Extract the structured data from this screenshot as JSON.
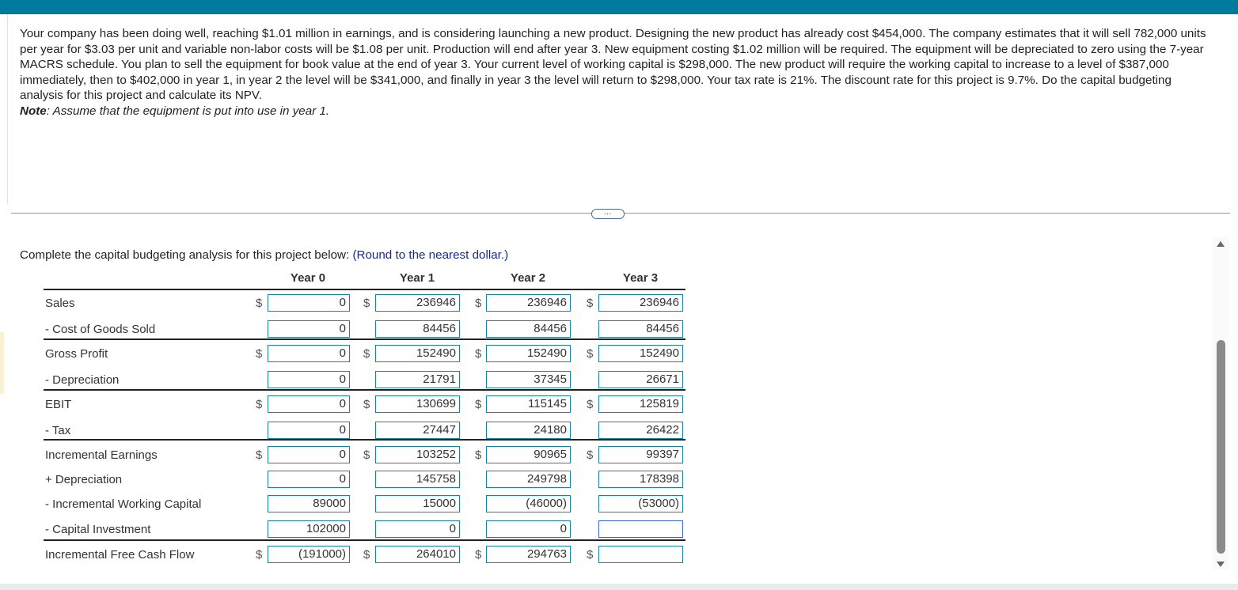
{
  "problem": {
    "text": "Your company has been doing well, reaching $1.01 million in earnings, and is considering launching a new product. Designing the new product has already cost $454,000. The company estimates that it will sell 782,000 units per year for $3.03 per unit and variable non-labor costs will be $1.08 per unit. Production will end after year 3. New equipment costing $1.02 million will be required. The equipment will be depreciated to zero using the 7-year MACRS schedule. You plan to sell the equipment for book value at the end of year 3. Your current level of working capital is $298,000. The new product will require the working capital to increase to a level of $387,000 immediately, then to $402,000 in year 1, in year 2 the level will be $341,000, and finally in year 3 the level will return to $298,000. Your tax rate is 21%. The discount rate for this project is 9.7%. Do the capital budgeting analysis for this project and calculate its NPV.",
    "note_label": "Note",
    "note_text": ": Assume that the equipment is put into use in year 1."
  },
  "more_button": "…",
  "instruction": {
    "text": "Complete the capital budgeting analysis for this project below:",
    "round": "(Round to the nearest dollar.)"
  },
  "years": [
    "Year 0",
    "Year 1",
    "Year 2",
    "Year 3"
  ],
  "currency": "$",
  "rows": [
    {
      "label": "Sales",
      "dollar": true,
      "values": [
        "0",
        "236946",
        "236946",
        "236946"
      ]
    },
    {
      "label": "- Cost of Goods Sold",
      "dollar": false,
      "values": [
        "0",
        "84456",
        "84456",
        "84456"
      ]
    },
    {
      "label": "Gross Profit",
      "dollar": true,
      "values": [
        "0",
        "152490",
        "152490",
        "152490"
      ]
    },
    {
      "label": "- Depreciation",
      "dollar": false,
      "values": [
        "0",
        "21791",
        "37345",
        "26671"
      ]
    },
    {
      "label": "EBIT",
      "dollar": true,
      "values": [
        "0",
        "130699",
        "115145",
        "125819"
      ]
    },
    {
      "label": "- Tax",
      "dollar": false,
      "values": [
        "0",
        "27447",
        "24180",
        "26422"
      ]
    },
    {
      "label": "Incremental Earnings",
      "dollar": true,
      "values": [
        "0",
        "103252",
        "90965",
        "99397"
      ]
    },
    {
      "label": "+ Depreciation",
      "dollar": false,
      "values": [
        "0",
        "145758",
        "249798",
        "178398"
      ]
    },
    {
      "label": "- Incremental Working Capital",
      "dollar": false,
      "values": [
        "89000",
        "15000",
        "(46000)",
        "(53000)"
      ]
    },
    {
      "label": "- Capital Investment",
      "dollar": false,
      "values": [
        "102000",
        "0",
        "0",
        ""
      ]
    },
    {
      "label": "Incremental Free Cash Flow",
      "dollar": true,
      "values": [
        "(191000)",
        "264010",
        "294763",
        ""
      ]
    }
  ],
  "colors": {
    "header_bar": "#00799e",
    "input_border": "#17839e",
    "active_input_border": "#3a63c9"
  }
}
